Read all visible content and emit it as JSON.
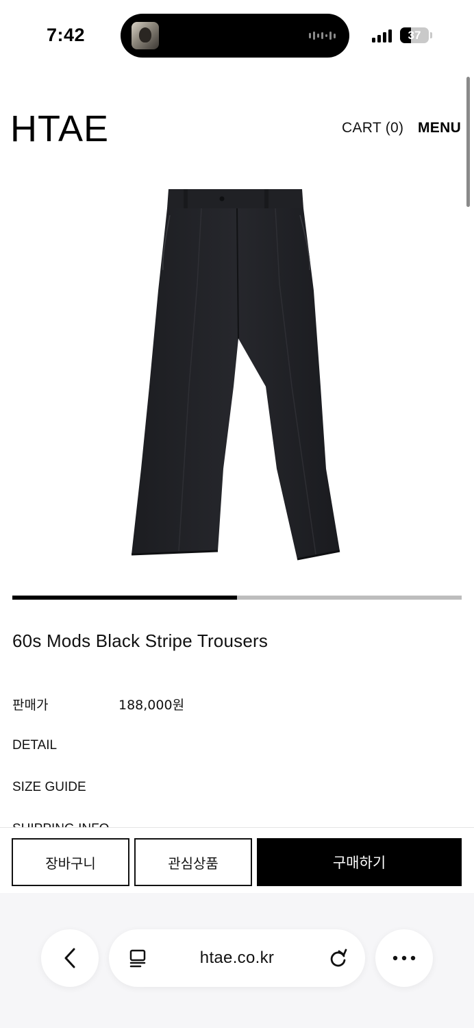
{
  "status_bar": {
    "time": "7:42",
    "battery_level": "37",
    "battery_fraction": 0.37,
    "signal_bars": 4
  },
  "header": {
    "logo": "HTAE",
    "cart": "CART (0)",
    "menu": "MENU"
  },
  "gallery": {
    "progress_fraction": 0.5
  },
  "product": {
    "title": "60s Mods Black Stripe Trousers",
    "price_label": "판매가",
    "price_value": "188,000원",
    "detail_label": "DETAIL",
    "size_guide_label": "SIZE GUIDE",
    "shipping_label": "SHIPPING INFO"
  },
  "actions": {
    "cart_label": "장바구니",
    "wishlist_label": "관심상품",
    "buy_label": "구매하기"
  },
  "browser": {
    "url": "htae.co.kr",
    "back_icon": "chevron-left-icon",
    "reader_icon": "reader-icon",
    "reload_icon": "reload-icon",
    "more_icon": "more-icon"
  },
  "colors": {
    "primary": "#000000",
    "track": "#bdbdbd",
    "browser_bg": "#f6f6f8"
  }
}
